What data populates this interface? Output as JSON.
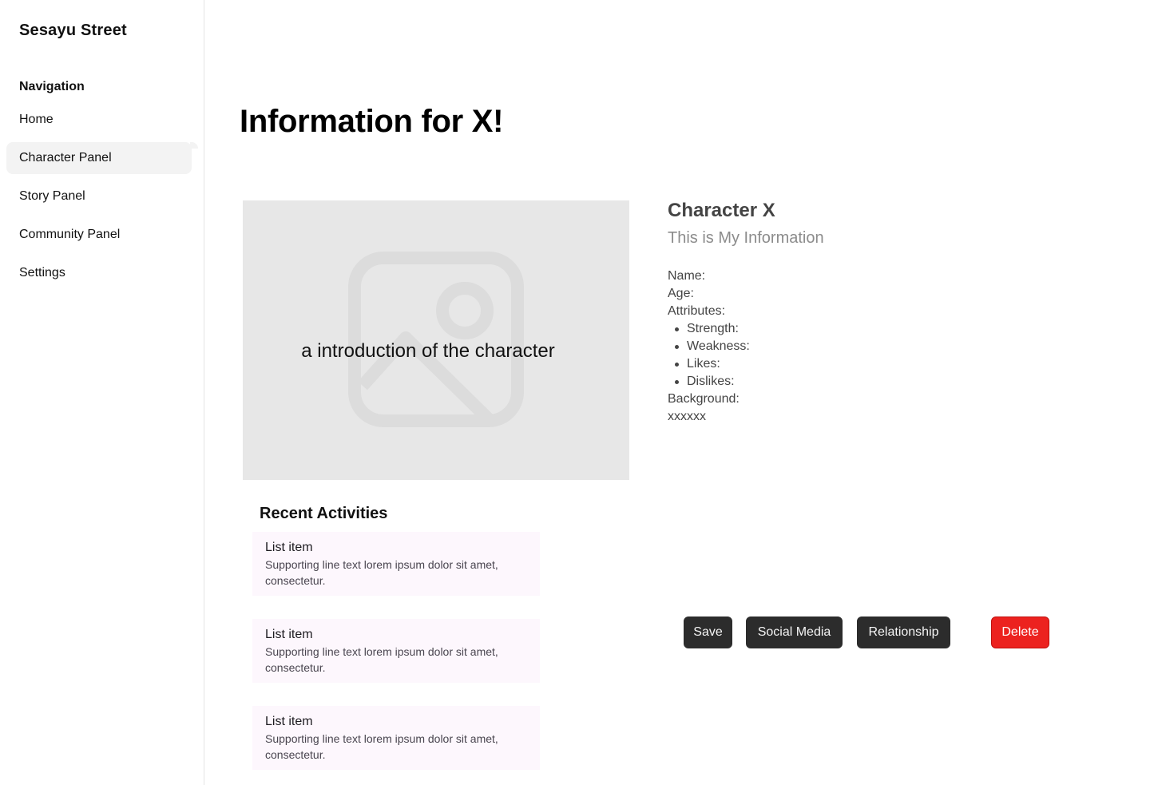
{
  "app": {
    "brand": "Sesayu Street"
  },
  "sidebar": {
    "heading": "Navigation",
    "items": [
      {
        "label": "Home",
        "active": false
      },
      {
        "label": "Character Panel",
        "active": true
      },
      {
        "label": "Story Panel",
        "active": false
      },
      {
        "label": "Community Panel",
        "active": false
      },
      {
        "label": "Settings",
        "active": false
      }
    ]
  },
  "main": {
    "title": "Information for X!",
    "image": {
      "caption": "a introduction of the character",
      "icon": "image-placeholder-icon"
    },
    "character": {
      "name": "Character X",
      "subtitle": "This is My Information",
      "fields": {
        "name": "Name:",
        "age": "Age:",
        "attributes": "Attributes:",
        "attribute_list": [
          "Strength:",
          "Weakness:",
          "Likes:",
          "Dislikes:"
        ],
        "background": "Background:",
        "background_value": "xxxxxx"
      }
    },
    "recent": {
      "title": "Recent Activities",
      "items": [
        {
          "title": "List item",
          "supporting": "Supporting line text lorem ipsum dolor sit amet, consectetur."
        },
        {
          "title": "List item",
          "supporting": "Supporting line text lorem ipsum dolor sit amet, consectetur."
        },
        {
          "title": "List item",
          "supporting": "Supporting line text lorem ipsum dolor sit amet, consectetur."
        }
      ]
    },
    "actions": {
      "save": "Save",
      "social_media": "Social Media",
      "relationship": "Relationship",
      "delete": "Delete"
    }
  },
  "colors": {
    "primary_button": "#2c2c2c",
    "danger_button": "#ec221f",
    "active_nav_bg": "#f3f3f3",
    "image_placeholder_bg": "#e7e7e7",
    "list_item_bg": "#fdf7fd"
  }
}
